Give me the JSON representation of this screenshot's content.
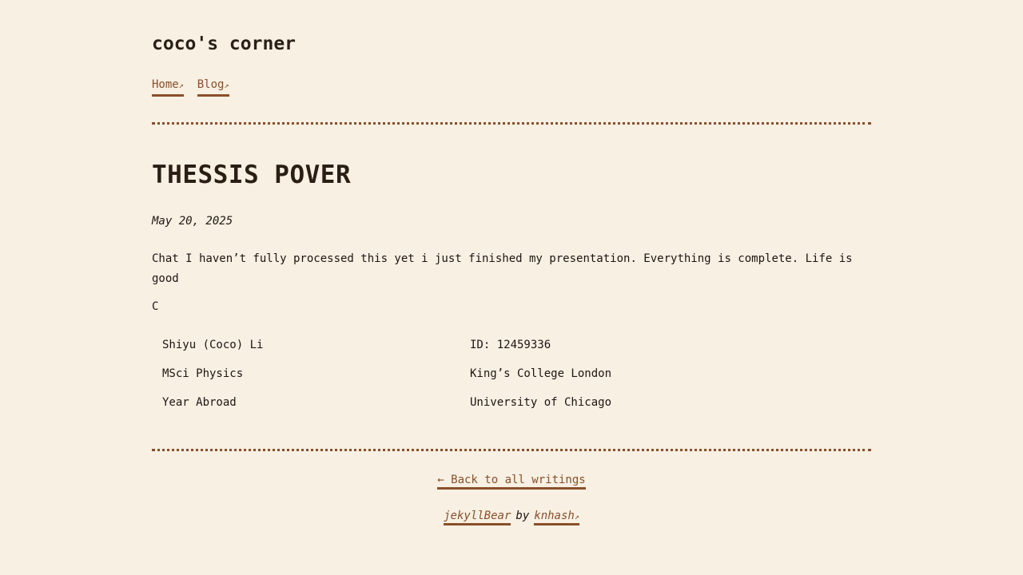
{
  "site": {
    "title": "coco's corner"
  },
  "nav": {
    "items": [
      {
        "label": "Home",
        "icon": "external-arrow-icon"
      },
      {
        "label": "Blog",
        "icon": "external-arrow-icon"
      }
    ],
    "arrow_glyph": "↗"
  },
  "post": {
    "title": "THESSIS POVER",
    "date": "May 20, 2025",
    "body": "Chat I haven’t fully processed this yet i just finished my presentation. Everything is complete. Life is good",
    "signature": "C",
    "info_table": [
      [
        "Shiyu (Coco) Li",
        "ID: 12459336"
      ],
      [
        "MSci Physics",
        "King’s College London"
      ],
      [
        "Year Abroad",
        "University of Chicago"
      ]
    ]
  },
  "footer": {
    "back_link": "← Back to all writings",
    "theme_link": "jekyllBear",
    "by_text": "by",
    "author_link": "knhash",
    "arrow_glyph": "↗"
  },
  "colors": {
    "background": "#f7f0e3",
    "accent": "#8a4f2a",
    "text": "#1e1510"
  }
}
